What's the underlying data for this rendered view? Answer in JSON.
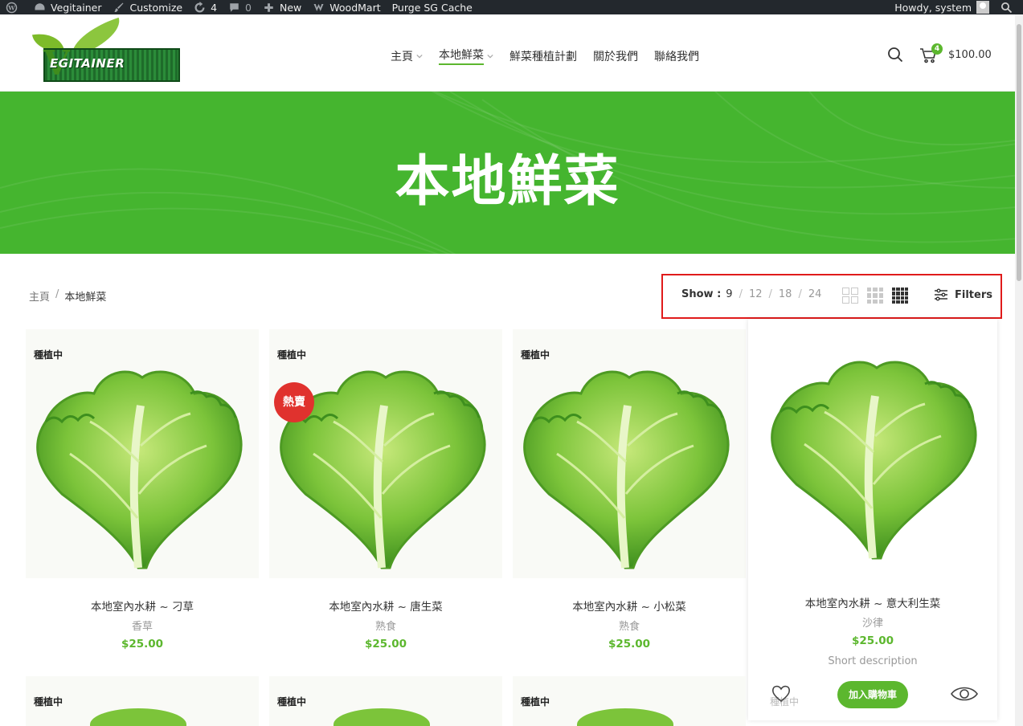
{
  "admin_bar": {
    "items": [
      {
        "icon": "wordpress-icon",
        "label": ""
      },
      {
        "icon": "dashboard-icon",
        "label": "Vegitainer"
      },
      {
        "icon": "brush-icon",
        "label": "Customize"
      },
      {
        "icon": "updates-icon",
        "label": "4"
      },
      {
        "icon": "comment-icon",
        "label": "0"
      },
      {
        "icon": "plus-icon",
        "label": "New"
      },
      {
        "icon": "woodmart-icon",
        "label": "WoodMart"
      },
      {
        "icon": "",
        "label": "Purge SG Cache"
      }
    ],
    "greeting": "Howdy, system"
  },
  "header": {
    "logo_text": "EGITAINER",
    "nav": [
      {
        "label": "主頁",
        "has_caret": true,
        "active": false
      },
      {
        "label": "本地鮮菜",
        "has_caret": true,
        "active": true
      },
      {
        "label": "鮮菜種植計劃",
        "has_caret": false,
        "active": false
      },
      {
        "label": "關於我們",
        "has_caret": false,
        "active": false
      },
      {
        "label": "聯絡我們",
        "has_caret": false,
        "active": false
      }
    ],
    "cart_count": "4",
    "cart_total": "$100.00"
  },
  "banner": {
    "title": "本地鮮菜"
  },
  "breadcrumb": {
    "home": "主頁",
    "separator": "/",
    "current": "本地鮮菜"
  },
  "toolbar": {
    "show_label": "Show :",
    "options": [
      "9",
      "12",
      "18",
      "24"
    ],
    "selected": "9",
    "filters_label": "Filters"
  },
  "products": [
    {
      "tag": "種植中",
      "name": "本地室內水耕 ~ 刁草",
      "category": "香草",
      "price": "$25.00",
      "badge": ""
    },
    {
      "tag": "種植中",
      "name": "本地室內水耕 ~ 唐生菜",
      "category": "熟食",
      "price": "$25.00",
      "badge": "熱賣"
    },
    {
      "tag": "種植中",
      "name": "本地室內水耕 ~ 小松菜",
      "category": "熟食",
      "price": "$25.00",
      "badge": ""
    }
  ],
  "hover_product": {
    "name": "本地室內水耕 ~ 意大利生菜",
    "category": "沙律",
    "price": "$25.00",
    "short_description": "Short description",
    "tag": "種植中",
    "add_to_cart": "加入購物車"
  },
  "row2_tags": [
    "種植中",
    "種植中",
    "種植中"
  ],
  "colors": {
    "accent": "#5cb72e",
    "banner": "#45b52f",
    "hot_badge": "#e0322e",
    "toolbar_highlight": "#e01b1b"
  }
}
